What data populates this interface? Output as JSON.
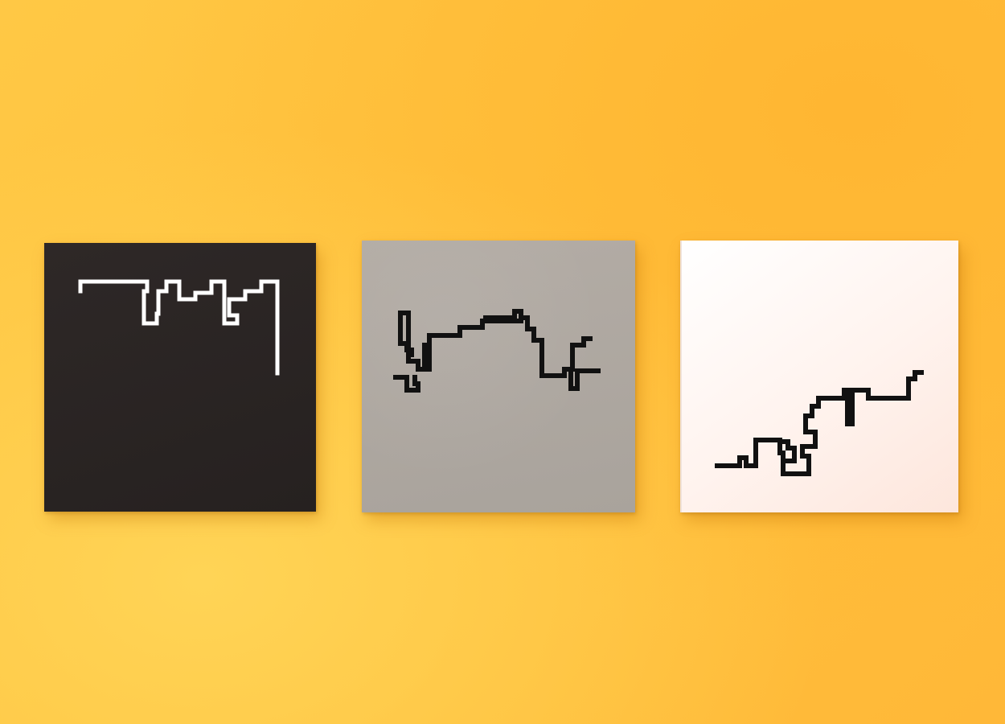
{
  "scene": {
    "background_color": "#ffc23d",
    "cards": [
      {
        "id": "black",
        "surface_color": "#2a2423",
        "line_color": "#ffffff"
      },
      {
        "id": "grey",
        "surface_color": "#aea8a1",
        "line_color": "#111111"
      },
      {
        "id": "white",
        "surface_color": "#fff6f2",
        "line_color": "#111111"
      }
    ]
  }
}
